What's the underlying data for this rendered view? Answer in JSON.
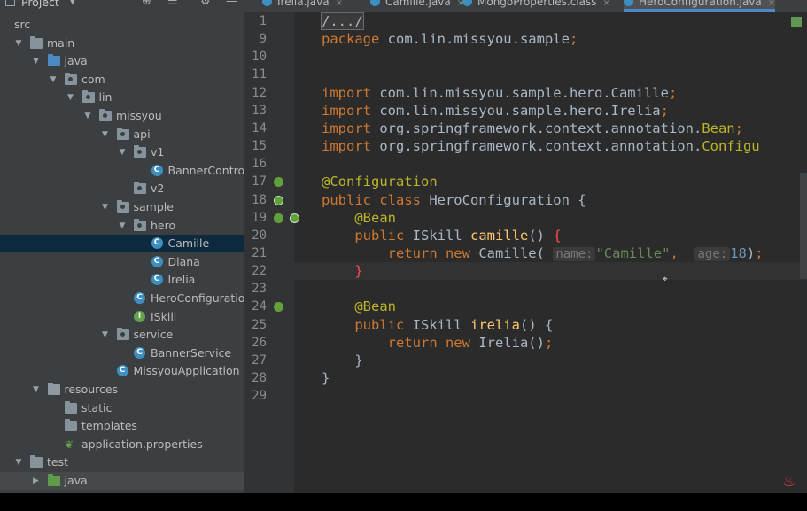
{
  "sidebar": {
    "title": "Project",
    "tree": [
      {
        "label": "src",
        "indent": 0,
        "arrow": "",
        "icon": "none"
      },
      {
        "label": "main",
        "indent": 0,
        "arrow": "down",
        "icon": "folder"
      },
      {
        "label": "java",
        "indent": 1,
        "arrow": "down",
        "icon": "folder-blue"
      },
      {
        "label": "com",
        "indent": 2,
        "arrow": "down",
        "icon": "package"
      },
      {
        "label": "lin",
        "indent": 3,
        "arrow": "down",
        "icon": "package"
      },
      {
        "label": "missyou",
        "indent": 4,
        "arrow": "down",
        "icon": "package"
      },
      {
        "label": "api",
        "indent": 5,
        "arrow": "down",
        "icon": "package"
      },
      {
        "label": "v1",
        "indent": 6,
        "arrow": "down",
        "icon": "package"
      },
      {
        "label": "BannerController",
        "indent": 7,
        "arrow": "",
        "icon": "class"
      },
      {
        "label": "v2",
        "indent": 6,
        "arrow": "",
        "icon": "package"
      },
      {
        "label": "sample",
        "indent": 5,
        "arrow": "down",
        "icon": "package"
      },
      {
        "label": "hero",
        "indent": 6,
        "arrow": "down",
        "icon": "package"
      },
      {
        "label": "Camille",
        "indent": 7,
        "arrow": "",
        "icon": "class",
        "selected": true
      },
      {
        "label": "Diana",
        "indent": 7,
        "arrow": "",
        "icon": "class"
      },
      {
        "label": "Irelia",
        "indent": 7,
        "arrow": "",
        "icon": "class"
      },
      {
        "label": "HeroConfiguration",
        "indent": 6,
        "arrow": "",
        "icon": "class"
      },
      {
        "label": "ISkill",
        "indent": 6,
        "arrow": "",
        "icon": "interface"
      },
      {
        "label": "service",
        "indent": 5,
        "arrow": "down",
        "icon": "package"
      },
      {
        "label": "BannerService",
        "indent": 6,
        "arrow": "",
        "icon": "class"
      },
      {
        "label": "MissyouApplication",
        "indent": 5,
        "arrow": "",
        "icon": "app"
      },
      {
        "label": "resources",
        "indent": 1,
        "arrow": "down",
        "icon": "folder-res"
      },
      {
        "label": "static",
        "indent": 2,
        "arrow": "",
        "icon": "folder"
      },
      {
        "label": "templates",
        "indent": 2,
        "arrow": "",
        "icon": "folder"
      },
      {
        "label": "application.properties",
        "indent": 2,
        "arrow": "",
        "icon": "leaf"
      },
      {
        "label": "test",
        "indent": 0,
        "arrow": "down",
        "icon": "folder"
      },
      {
        "label": "java",
        "indent": 1,
        "arrow": "right",
        "icon": "folder-green",
        "highlight": true
      }
    ]
  },
  "tabs": [
    {
      "label": "Irelia.java"
    },
    {
      "label": "Camille.java"
    },
    {
      "label": "MongoProperties.class"
    },
    {
      "label": "HeroConfiguration.java",
      "active": true
    }
  ],
  "editor": {
    "lines": [
      {
        "n": "1",
        "html": "<span class=\"fold\">/.../</span>"
      },
      {
        "n": "9",
        "html": "<span class=\"kw\">package</span> com.lin.missyou.sample<span class=\"kw\">;</span>"
      },
      {
        "n": "10",
        "html": ""
      },
      {
        "n": "11",
        "html": ""
      },
      {
        "n": "12",
        "html": "<span class=\"kw\">import</span> com.lin.missyou.sample.hero.Camille<span class=\"kw\">;</span>"
      },
      {
        "n": "13",
        "html": "<span class=\"kw\">import</span> com.lin.missyou.sample.hero.Irelia<span class=\"kw\">;</span>"
      },
      {
        "n": "14",
        "html": "<span class=\"kw\">import</span> org.springframework.context.annotation.<span class=\"ann\">Bean</span><span class=\"kw\">;</span>"
      },
      {
        "n": "15",
        "html": "<span class=\"kw\">import</span> org.springframework.context.annotation.<span class=\"ann\">Configu</span>"
      },
      {
        "n": "16",
        "html": ""
      },
      {
        "n": "17",
        "html": "<span class=\"ann\">@Configuration</span>"
      },
      {
        "n": "18",
        "html": "<span class=\"kw\">public class</span> HeroConfiguration {"
      },
      {
        "n": "19",
        "html": "    <span class=\"ann\">@Bean</span>"
      },
      {
        "n": "20",
        "html": "    <span class=\"kw\">public</span> ISkill <span class=\"fn\">camille</span>() <span class=\"redbrace\">{</span>"
      },
      {
        "n": "21",
        "html": "        <span class=\"kw\">return new</span> Camille( <span class=\"hint\">name:</span><span class=\"str\">\"Camille\"</span><span class=\"kw\">,</span>  <span class=\"hint\">age:</span><span class=\"num\">18</span>)<span class=\"kw\">;</span>"
      },
      {
        "n": "22",
        "html": "    <span class=\"redbrace\">}</span>",
        "current": true
      },
      {
        "n": "23",
        "html": ""
      },
      {
        "n": "24",
        "html": "    <span class=\"ann\">@Bean</span>"
      },
      {
        "n": "25",
        "html": "    <span class=\"kw\">public</span> ISkill <span class=\"fn\">irelia</span>() {"
      },
      {
        "n": "26",
        "html": "        <span class=\"kw\">return new</span> Irelia()<span class=\"kw\">;</span>"
      },
      {
        "n": "27",
        "html": "    }"
      },
      {
        "n": "28",
        "html": "}"
      },
      {
        "n": "29",
        "html": ""
      }
    ],
    "gutter_icons": [
      {
        "line": "17",
        "type": "spring-bean-icon"
      },
      {
        "line": "18",
        "type": "spring-config-icon"
      },
      {
        "line": "19",
        "type": "spring-bean-icon"
      },
      {
        "line": "24",
        "type": "spring-bean-icon"
      }
    ]
  },
  "colors": {
    "sidebar_bg": "#3c3f41",
    "editor_bg": "#2b2b2b",
    "selection": "#0d293e",
    "keyword": "#cc7832",
    "annotation": "#bbb529",
    "string": "#6a8759",
    "number": "#6897bb"
  }
}
